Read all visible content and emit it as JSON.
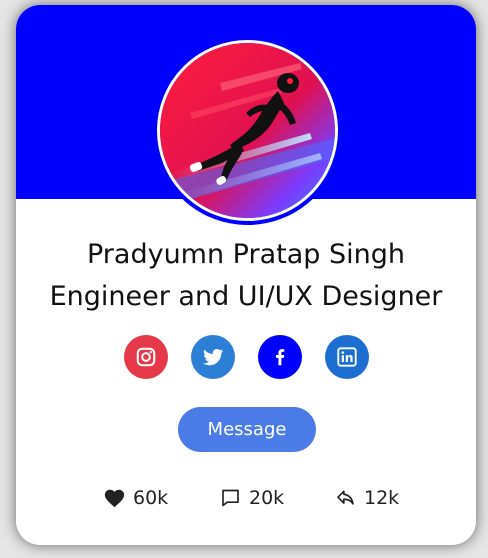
{
  "profile": {
    "name": "Pradyumn Pratap Singh",
    "role": "Engineer and UI/UX Designer"
  },
  "colors": {
    "banner": "#0000ff",
    "instagram": "#e1306c",
    "twitter": "#2d7fd6",
    "facebook": "#0000ff",
    "linkedin": "#1c6fd1",
    "message_button": "#4a7be6"
  },
  "socials": [
    {
      "name": "instagram",
      "icon": "instagram-icon"
    },
    {
      "name": "twitter",
      "icon": "twitter-icon"
    },
    {
      "name": "facebook",
      "icon": "facebook-icon"
    },
    {
      "name": "linkedin",
      "icon": "linkedin-icon"
    }
  ],
  "actions": {
    "message_label": "Message"
  },
  "stats": {
    "likes": "60k",
    "comments": "20k",
    "shares": "12k"
  }
}
